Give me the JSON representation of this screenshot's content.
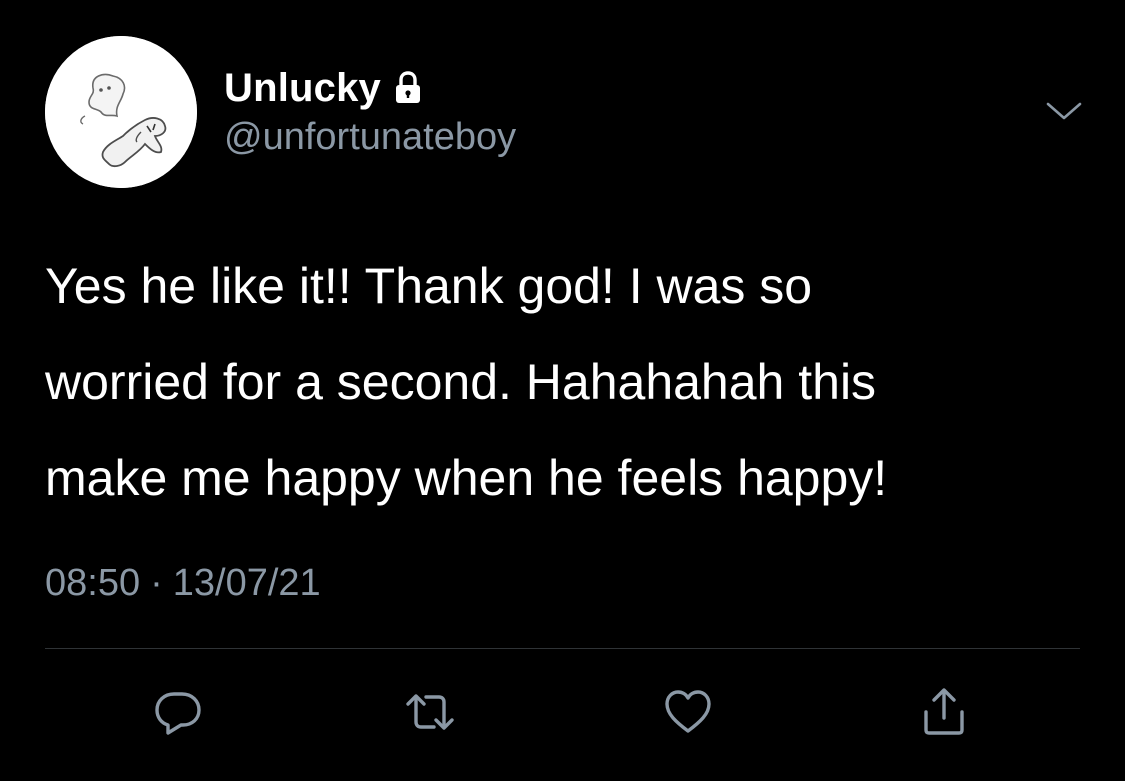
{
  "author": {
    "display_name": "Unlucky",
    "handle": "@unfortunateboy",
    "protected": true
  },
  "tweet": {
    "text": "Yes he like it!! Thank god! I was so\nworried for a second. Hahahahah this\nmake me happy when he feels happy!",
    "time": "08:50",
    "separator": "·",
    "date": "13/07/21"
  },
  "icons": {
    "lock": "lock-icon",
    "caret": "chevron-down-icon",
    "reply": "reply-icon",
    "retweet": "retweet-icon",
    "like": "heart-icon",
    "share": "share-icon"
  },
  "colors": {
    "background": "#000000",
    "primary_text": "#ffffff",
    "secondary_text": "#8b98a5",
    "divider": "#2f3336"
  }
}
